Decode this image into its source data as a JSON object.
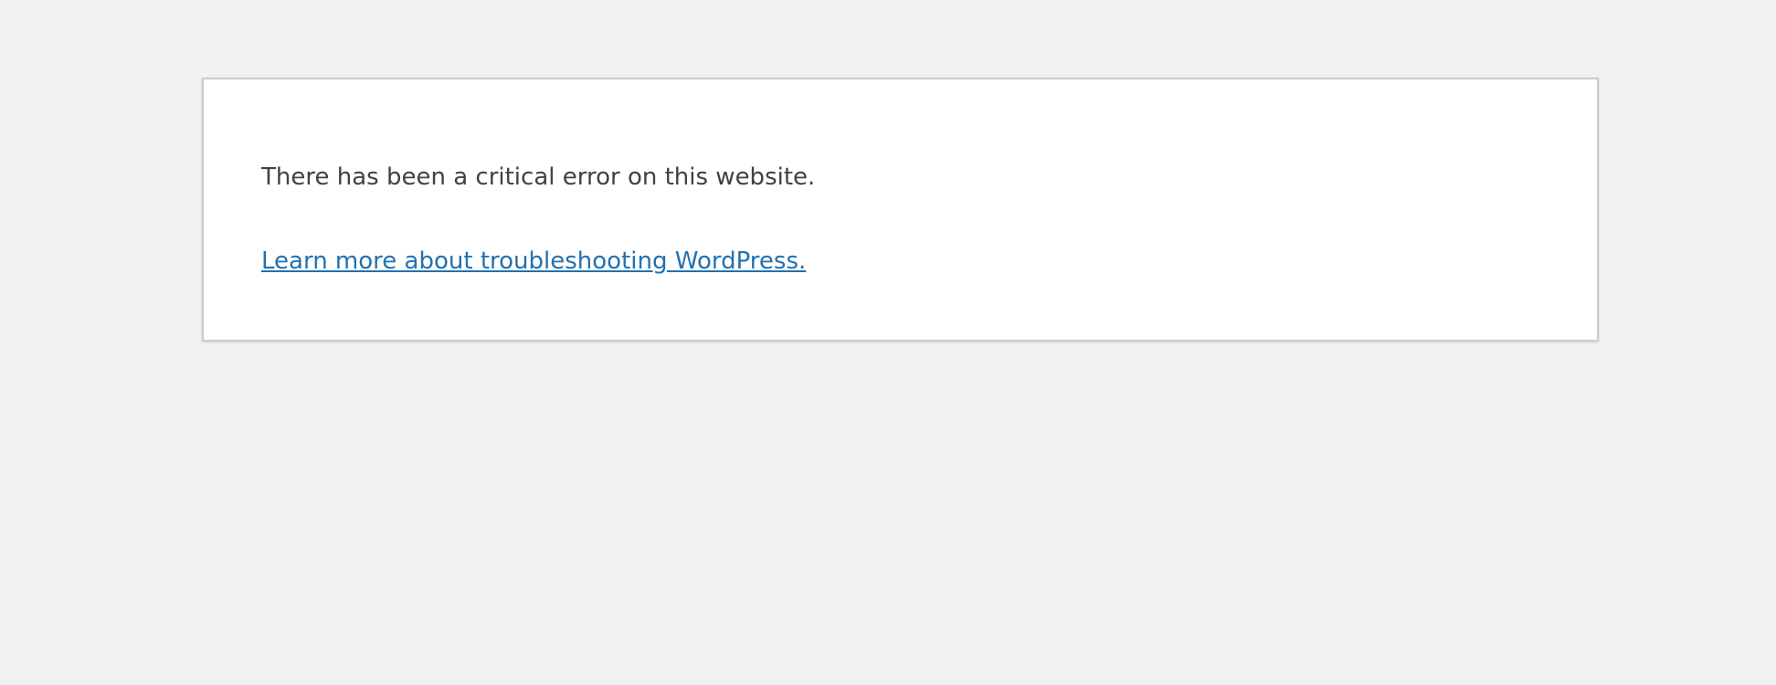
{
  "error": {
    "message": "There has been a critical error on this website.",
    "link_text": "Learn more about troubleshooting WordPress."
  },
  "colors": {
    "page_background": "#f1f1f1",
    "panel_background": "#ffffff",
    "panel_border": "#cccccc",
    "text": "#3c434a",
    "link": "#2271b1"
  }
}
